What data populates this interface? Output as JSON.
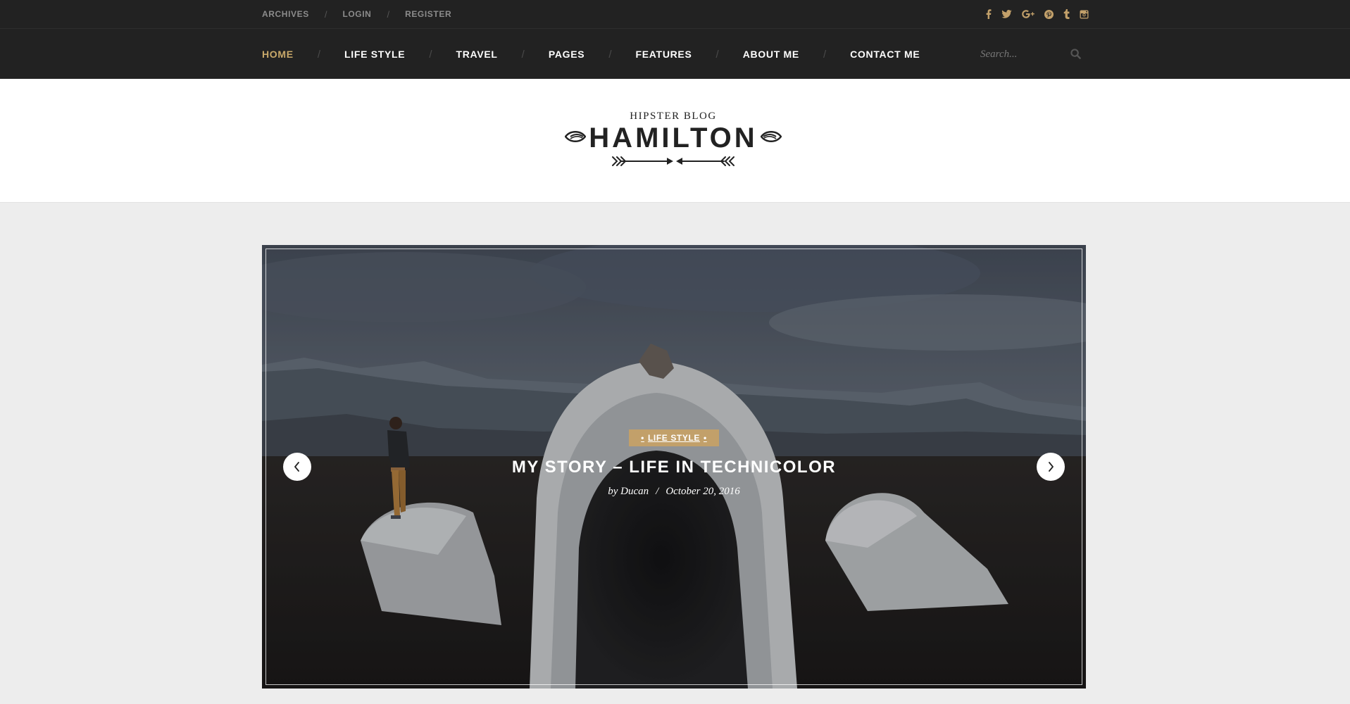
{
  "topbar": {
    "links": [
      "ARCHIVES",
      "LOGIN",
      "REGISTER"
    ],
    "separator": "/",
    "social": [
      {
        "icon": "facebook-icon",
        "glyph": "f"
      },
      {
        "icon": "twitter-icon",
        "glyph": "🐦"
      },
      {
        "icon": "google-plus-icon",
        "glyph": "G+"
      },
      {
        "icon": "pinterest-icon",
        "glyph": "℗"
      },
      {
        "icon": "tumblr-icon",
        "glyph": "t"
      },
      {
        "icon": "instagram-icon",
        "glyph": "◙"
      }
    ]
  },
  "nav": {
    "items": [
      "HOME",
      "LIFE STYLE",
      "TRAVEL",
      "PAGES",
      "FEATURES",
      "ABOUT ME",
      "CONTACT ME"
    ],
    "active": "HOME",
    "separator": "/",
    "search_placeholder": "Search..."
  },
  "logo": {
    "tagline": "HIPSTER BLOG",
    "name": "HAMILTON"
  },
  "slide": {
    "category": "LIFE STYLE",
    "category_dot": "•",
    "title": "MY STORY – LIFE IN TECHNICOLOR",
    "author": "by Ducan",
    "meta_separator": "/",
    "date": "October 20, 2016"
  },
  "colors": {
    "dark_bar": "#222222",
    "accent": "#c2a06a",
    "active_nav": "#c9a96a",
    "page_bg": "#ededed"
  }
}
